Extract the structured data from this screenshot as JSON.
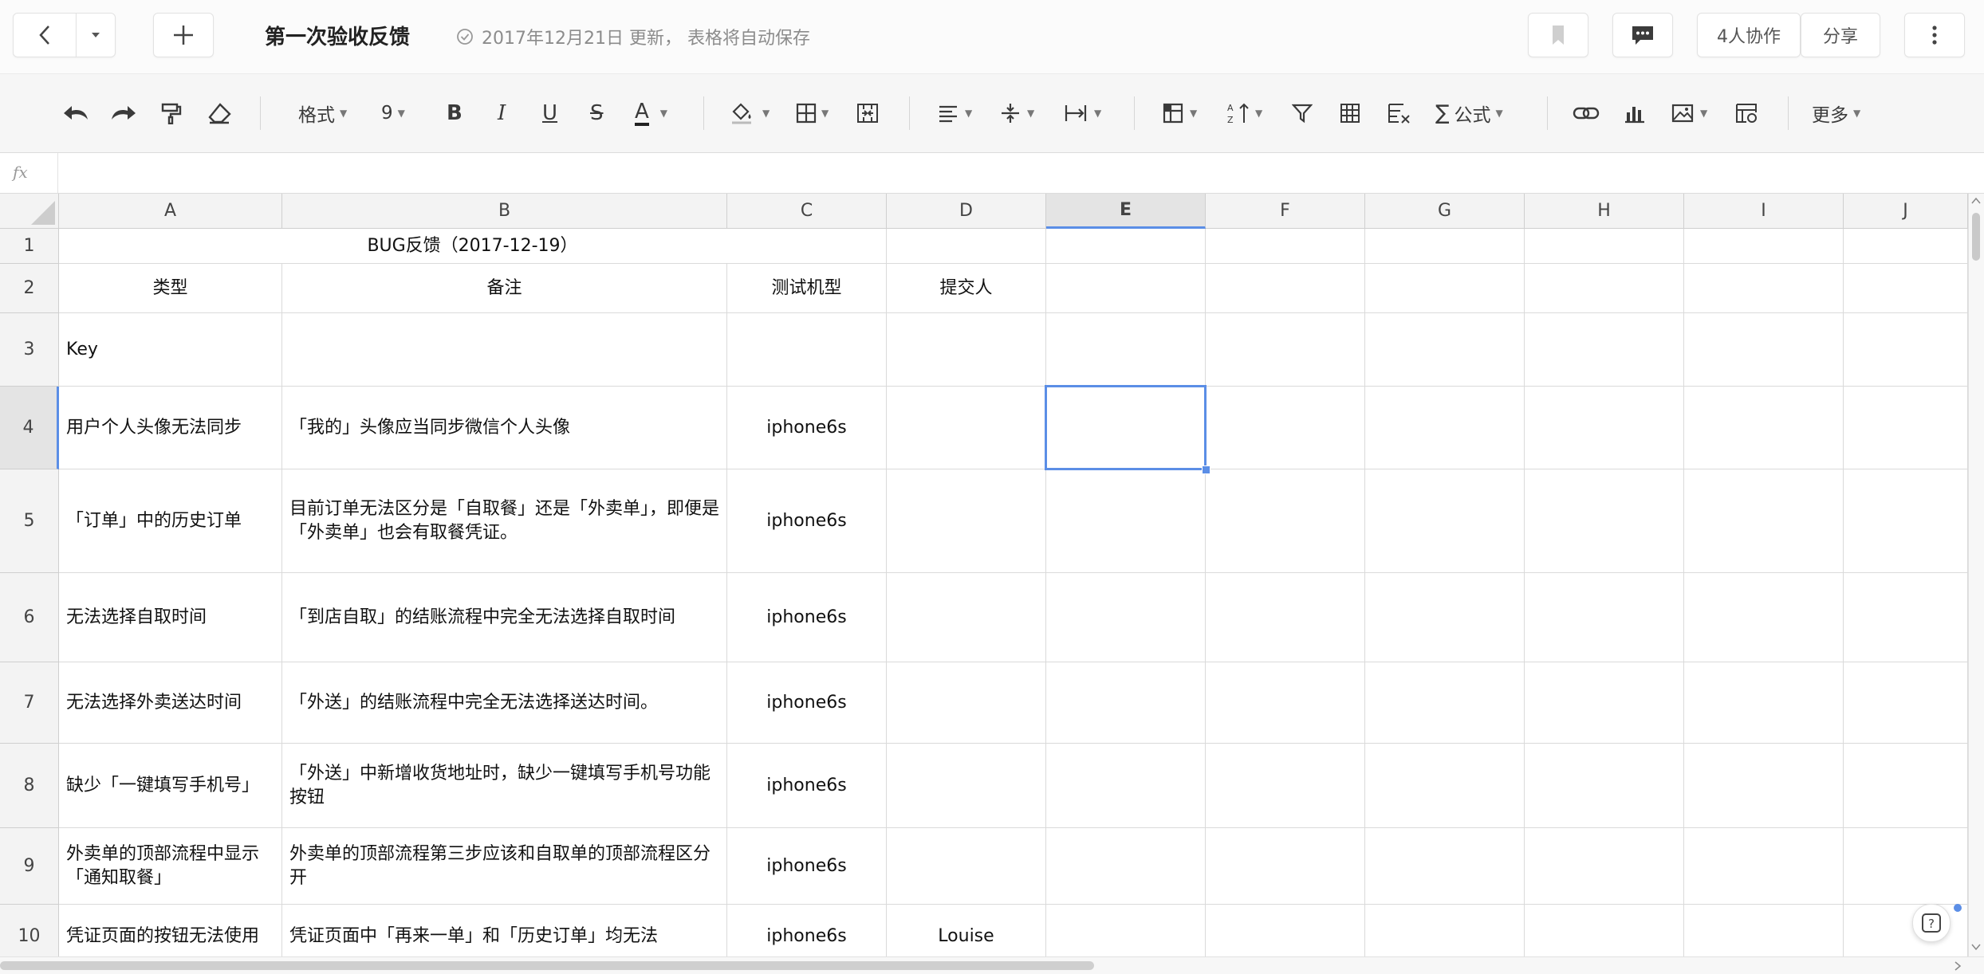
{
  "header": {
    "title": "第一次验收反馈",
    "save_status": "2017年12月21日 更新， 表格将自动保存",
    "collab": "4人协作",
    "share": "分享"
  },
  "toolbar": {
    "format": "格式",
    "font_size": "9",
    "bold": "B",
    "italic": "I",
    "underline": "U",
    "strike": "S",
    "text_color": "A",
    "formula": "公式",
    "more": "更多"
  },
  "formula_bar": {
    "fx": "fx"
  },
  "columns": [
    "A",
    "B",
    "C",
    "D",
    "E",
    "F",
    "G",
    "H",
    "I",
    "J"
  ],
  "selected_column": "E",
  "selected_row": "4",
  "rows": [
    {
      "n": "1",
      "cells": [
        "BUG反馈（2017-12-19）"
      ]
    },
    {
      "n": "2",
      "cells": [
        "类型",
        "备注",
        "测试机型",
        "提交人"
      ]
    },
    {
      "n": "3",
      "cells": [
        "Key",
        "",
        "",
        ""
      ]
    },
    {
      "n": "4",
      "cells": [
        "用户个人头像无法同步",
        "「我的」头像应当同步微信个人头像",
        "iphone6s",
        ""
      ]
    },
    {
      "n": "5",
      "cells": [
        "「订单」中的历史订单",
        "目前订单无法区分是「自取餐」还是「外卖单」，即便是「外卖单」也会有取餐凭证。",
        "iphone6s",
        ""
      ]
    },
    {
      "n": "6",
      "cells": [
        "无法选择自取时间",
        "「到店自取」的结账流程中完全无法选择自取时间",
        "iphone6s",
        ""
      ]
    },
    {
      "n": "7",
      "cells": [
        "无法选择外卖送达时间",
        "「外送」的结账流程中完全无法选择送达时间。",
        "iphone6s",
        ""
      ]
    },
    {
      "n": "8",
      "cells": [
        "缺少「一键填写手机号」",
        "「外送」中新增收货地址时，缺少一键填写手机号功能按钮",
        "iphone6s",
        ""
      ]
    },
    {
      "n": "9",
      "cells": [
        "外卖单的顶部流程中显示「通知取餐」",
        "外卖单的顶部流程第三步应该和自取单的顶部流程区分开",
        "iphone6s",
        ""
      ]
    },
    {
      "n": "10",
      "cells": [
        "凭证页面的按钮无法使用",
        "凭证页面中「再来一单」和「历史订单」均无法",
        "iphone6s",
        "Louise"
      ]
    }
  ],
  "icons": {
    "back": "chevron-left-icon",
    "dropdown": "caret-down-icon",
    "new": "plus-icon",
    "saved": "check-circle-icon",
    "bookmark": "bookmark-icon",
    "comment": "comment-icon",
    "menu": "more-vertical-icon",
    "help": "question-icon"
  },
  "colors": {
    "accent": "#5b8ee6",
    "header_bg": "#f3f3f3",
    "toolbar_bg": "#f6f6f6"
  }
}
